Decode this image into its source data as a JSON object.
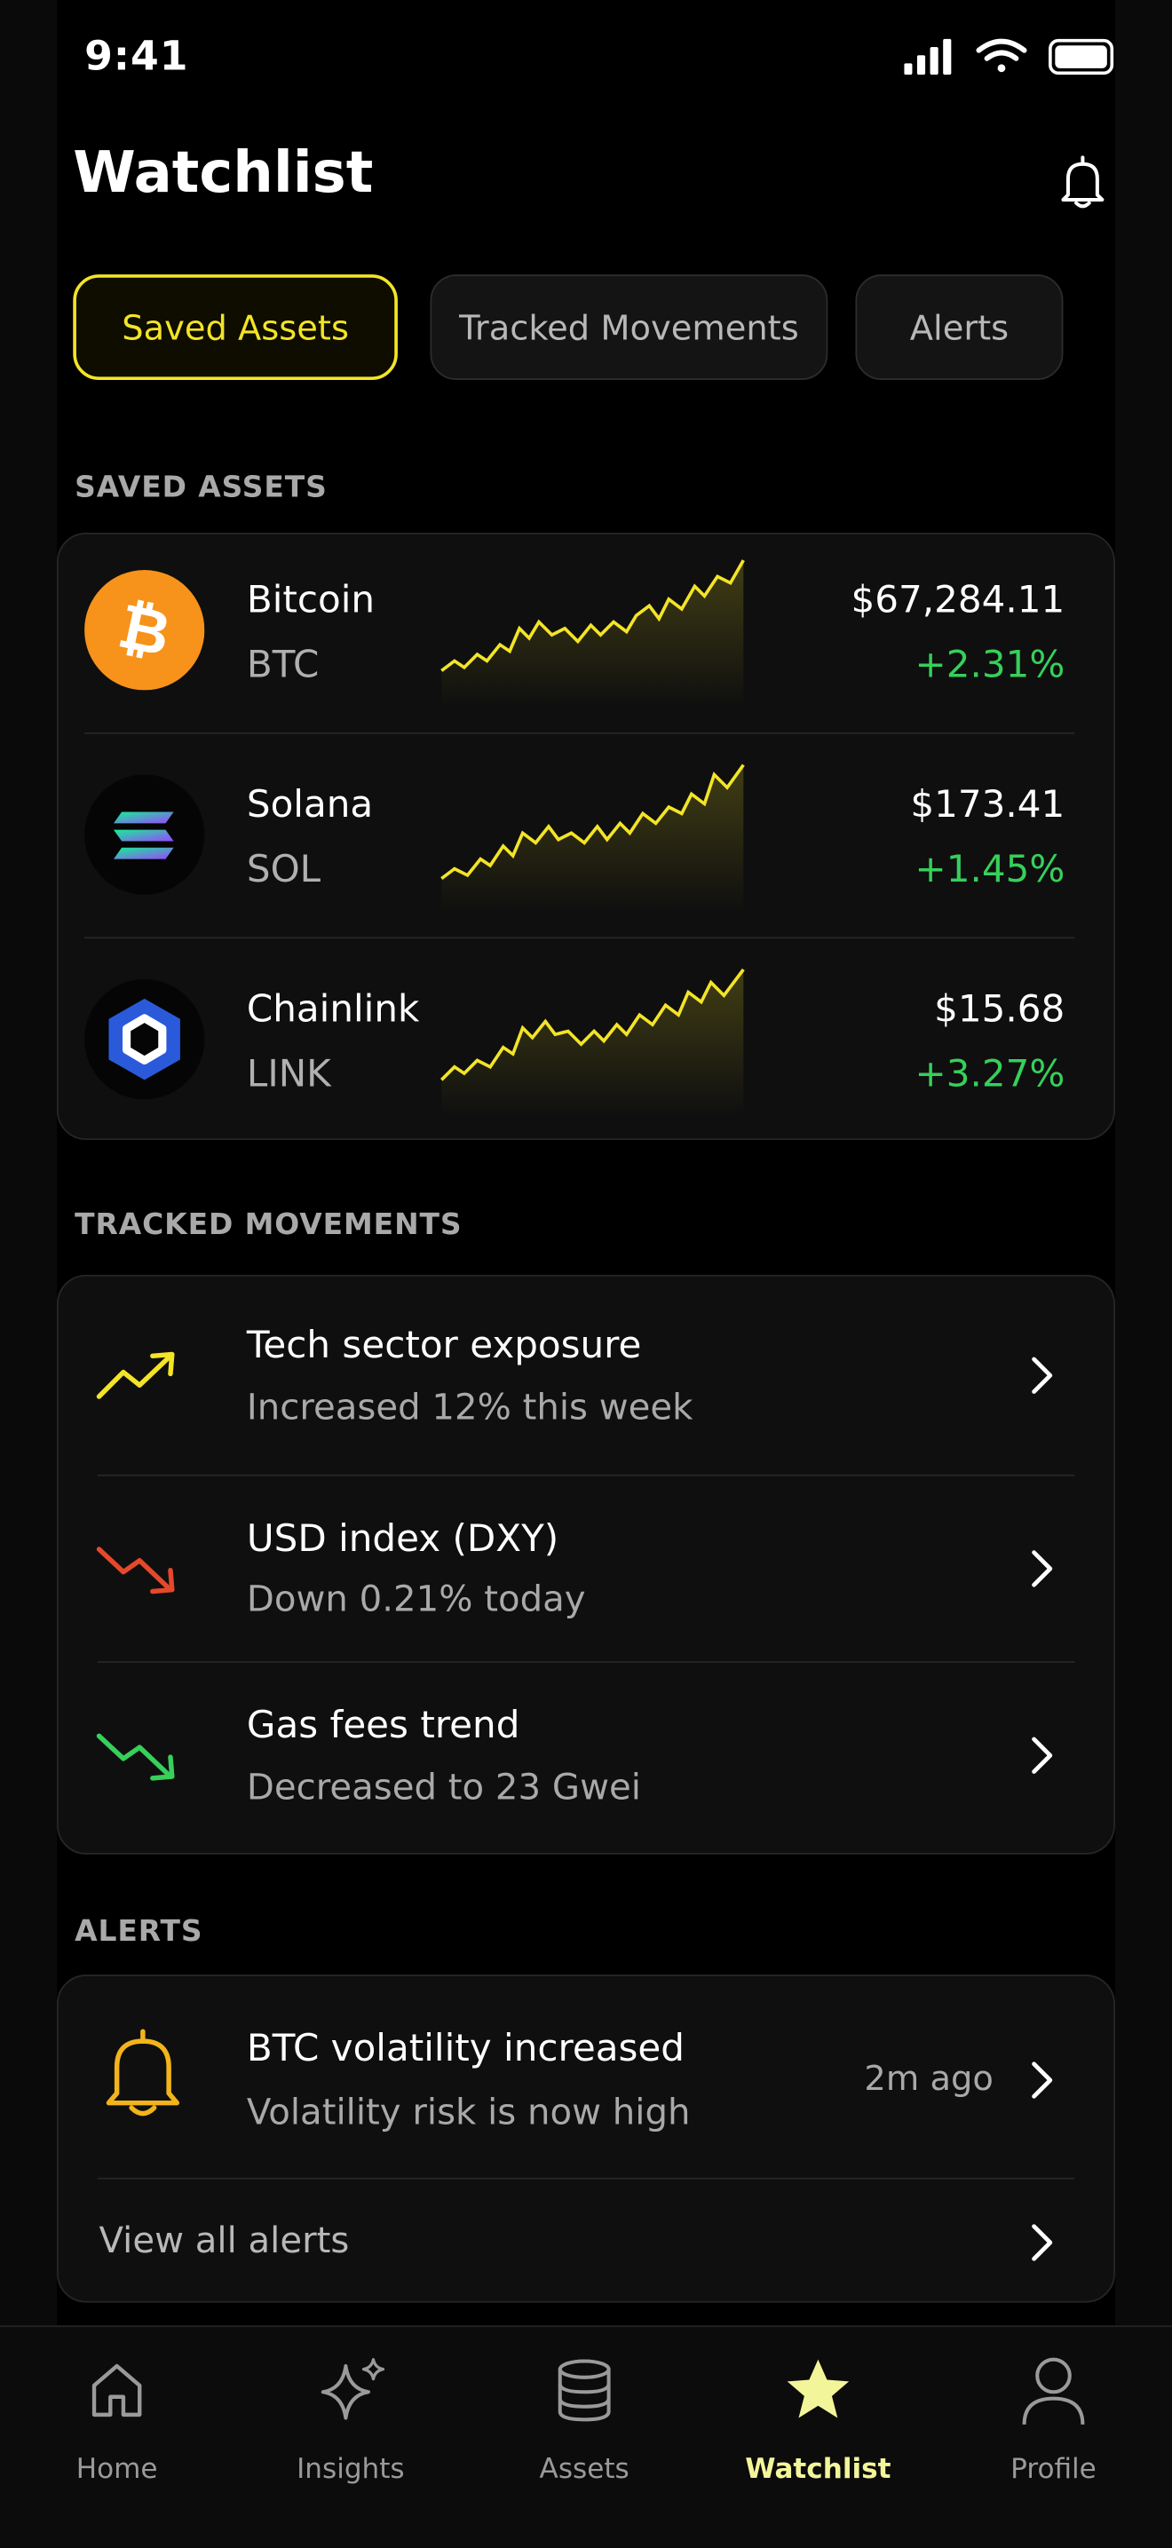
{
  "status_bar": {
    "time": "9:41"
  },
  "header": {
    "title": "Watchlist"
  },
  "tabs": [
    {
      "label": "Saved Assets",
      "active": true
    },
    {
      "label": "Tracked Movements",
      "active": false
    },
    {
      "label": "Alerts",
      "active": false
    }
  ],
  "saved_assets": {
    "section_label": "SAVED ASSETS",
    "items": [
      {
        "name": "Bitcoin",
        "ticker": "BTC",
        "price": "$67,284.11",
        "change": "+2.31%",
        "icon": "bitcoin-icon"
      },
      {
        "name": "Solana",
        "ticker": "SOL",
        "price": "$173.41",
        "change": "+1.45%",
        "icon": "solana-icon"
      },
      {
        "name": "Chainlink",
        "ticker": "LINK",
        "price": "$15.68",
        "change": "+3.27%",
        "icon": "chainlink-icon"
      }
    ]
  },
  "tracked_movements": {
    "section_label": "TRACKED MOVEMENTS",
    "items": [
      {
        "title": "Tech sector exposure",
        "subtitle": "Increased 12% this week",
        "icon": "trend-up-icon"
      },
      {
        "title": "USD index (DXY)",
        "subtitle": "Down 0.21% today",
        "icon": "trend-down-icon"
      },
      {
        "title": "Gas fees trend",
        "subtitle": "Decreased to 23 Gwei",
        "icon": "trend-down-icon"
      }
    ]
  },
  "alerts": {
    "section_label": "ALERTS",
    "items": [
      {
        "title": "BTC volatility increased",
        "subtitle": "Volatility risk is now high",
        "time": "2m ago",
        "icon": "bell-icon"
      }
    ],
    "view_all_label": "View all alerts"
  },
  "bottom_nav": [
    {
      "label": "Home",
      "icon": "home-icon",
      "active": false
    },
    {
      "label": "Insights",
      "icon": "sparkle-icon",
      "active": false
    },
    {
      "label": "Assets",
      "icon": "database-icon",
      "active": false
    },
    {
      "label": "Watchlist",
      "icon": "star-icon",
      "active": true
    },
    {
      "label": "Profile",
      "icon": "person-icon",
      "active": false
    }
  ],
  "colors": {
    "accent": "#f3e427",
    "positive": "#36d05a",
    "negative": "#e5482b",
    "background": "#000000"
  }
}
